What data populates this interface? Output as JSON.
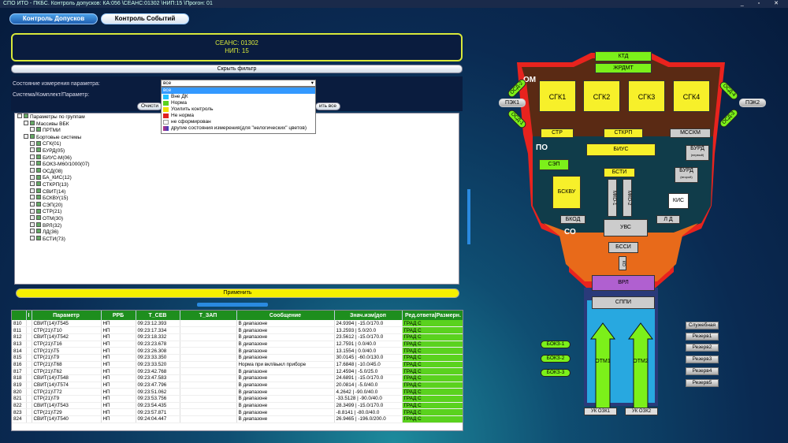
{
  "window": {
    "title": "СПО ИТО - ПКБС. Контроль допусков: КА:056 \\СЕАНС:01302 \\НИП:15 \\Прогон: 01",
    "controls": "_ ▫ ✕"
  },
  "tabs": [
    {
      "label": "Контроль Допусков"
    },
    {
      "label": "Контроль Событий"
    }
  ],
  "session": {
    "line1": "СЕАНС: 01302",
    "line2": "НИП: 15"
  },
  "filter": {
    "hide_label": "Скрыть фильтр",
    "state_label": "Состояние измерения параметра:",
    "system_label": "Система/Комплект/Параметр:",
    "select_value": "все",
    "options": [
      {
        "label": "все",
        "color": ""
      },
      {
        "label": "Вне ДК",
        "color": "#20c0ff"
      },
      {
        "label": "Норма",
        "color": "#5ad21e"
      },
      {
        "label": "Усилить контроль",
        "color": "#f0e000"
      },
      {
        "label": "Не норма",
        "color": "#e02020"
      },
      {
        "label": "не сформирован",
        "color": "#ffffff"
      },
      {
        "label": "другие состояния измерения(для \"нелогических\" цветов)",
        "color": "#c03080"
      }
    ],
    "btn_clear": "Очисти",
    "btn_select": "ить все",
    "apply": "Применить"
  },
  "tree": {
    "root": "Параметры по группам",
    "groups": [
      {
        "label": "Массивы ВБК",
        "items": [
          "ПРТМИ"
        ]
      },
      {
        "label": "Бортовые системы",
        "items": [
          "СГК(01)",
          "БУРД(05)",
          "БИУС-М(06)",
          "БОКЗ-М60/1000(07)",
          "ОСД(08)",
          "БА_КИС(12)",
          "СТКРП(13)",
          "СВИТ(14)",
          "БСКВУ(15)",
          "СЭП(20)",
          "СТР(21)",
          "ОТМ(30)",
          "ВРЛ(32)",
          "ЛД(36)",
          "БСТИ(73)"
        ]
      }
    ]
  },
  "table": {
    "columns": [
      "I",
      "Параметр",
      "РРБ",
      "Т_СЕВ",
      "Т_ЗАП",
      "Сообщение",
      "Знач.изм|доп",
      "Ред.ответа|Размерн."
    ],
    "rows": [
      [
        "810",
        "СВИТ(14)\\Т545",
        "НП",
        "09:23:12.393",
        "",
        "В диапазоне",
        "24.9394 | -15.0/170.0",
        "ГРАД С"
      ],
      [
        "811",
        "СТР(21)\\Т10",
        "НП",
        "09:23:17.334",
        "",
        "В диапазоне",
        "13.2593 | 5.0/20.0",
        "ГРАД С"
      ],
      [
        "812",
        "СВИТ(14)\\Т542",
        "НП",
        "09:23:18.332",
        "",
        "В диапазоне",
        "23.5612 | -15.0/170.0",
        "ГРАД С"
      ],
      [
        "813",
        "СТР(21)\\Т16",
        "НП",
        "09:23:23.678",
        "",
        "В диапазоне",
        "12.7591 | 0.0/40.0",
        "ГРАД С"
      ],
      [
        "814",
        "СТР(21)\\Т5",
        "НП",
        "09:23:26.308",
        "",
        "В диапазоне",
        "13.1554 | 0.0/40.0",
        "ГРАД С"
      ],
      [
        "815",
        "СТР(21)\\Т9",
        "НП",
        "09:23:33.350",
        "",
        "В диапазоне",
        "30.0145 | -60.0/130.0",
        "ГРАД С"
      ],
      [
        "816",
        "СТР(21)\\Т68",
        "НП",
        "09:23:33.520",
        "",
        "Норма при вкл/выкл приборе",
        "17.6848 | -10.0/45.0",
        "ГРАД С"
      ],
      [
        "817",
        "СТР(21)\\Т62",
        "НП",
        "09:23:42.768",
        "",
        "В диапазоне",
        "12.4594 | -5.0/25.0",
        "ГРАД С"
      ],
      [
        "818",
        "СВИТ(14)\\Т548",
        "НП",
        "09:23:47.583",
        "",
        "В диапазоне",
        "24.6891 | -15.0/170.0",
        "ГРАД С"
      ],
      [
        "819",
        "СВИТ(14)\\Т574",
        "НП",
        "09:23:47.796",
        "",
        "В диапазоне",
        "20.0814 | -5.0/40.0",
        "ГРАД С"
      ],
      [
        "820",
        "СТР(21)\\Т72",
        "НП",
        "09:23:51.062",
        "",
        "В диапазоне",
        "4.2642 | -90.0/40.0",
        "ГРАД С"
      ],
      [
        "821",
        "СТР(21)\\Т9",
        "НП",
        "09:23:53.756",
        "",
        "В диапазоне",
        "-33.5128 | -90.0/40.0",
        "ГРАД С"
      ],
      [
        "822",
        "СВИТ(14)\\Т543",
        "НП",
        "09:23:54.435",
        "",
        "В диапазоне",
        "28.3499 | -15.0/170.0",
        "ГРАД С"
      ],
      [
        "823",
        "СТР(21)\\Т29",
        "НП",
        "09:23:57.871",
        "",
        "В диапазоне",
        "-8.8141 | -80.0/40.0",
        "ГРАД С"
      ],
      [
        "824",
        "СВИТ(14)\\Т540",
        "НП",
        "09:24:04.447",
        "",
        "В диапазоне",
        "26.9465 | -196.0/200.0",
        "ГРАД С"
      ]
    ]
  },
  "diagram": {
    "top": [
      "КТД",
      "ЖРДМТ"
    ],
    "sections": [
      "ОМ",
      "ПО",
      "СО"
    ],
    "om": [
      "СГК1",
      "СГК2",
      "СГК3",
      "СГК4",
      "СТР",
      "СТКРП",
      "МССКМ"
    ],
    "po": [
      "БИУС",
      "СЭП",
      "БСТИ",
      "БСКВУ",
      "МКО-1",
      "МКО-2",
      "БУРД",
      "(первый)",
      "БУРД",
      "(второй)",
      "КИС",
      "БКОД",
      "УВС",
      "Л Д"
    ],
    "co": [
      "БССИ",
      "КО",
      "ВРЛ",
      "СППИ",
      "ОТМ1",
      "ОТМ2",
      "УК ОЗК1",
      "УК ОЗК2"
    ],
    "side_left": [
      "ПЭК1",
      "ОСД-2",
      "ОСД-1"
    ],
    "side_right": [
      "ОСД-4",
      "ОСД-3",
      "ПЭК2"
    ],
    "bokz": [
      "БОКЗ-1",
      "БОКЗ-2",
      "БОКЗ-3"
    ],
    "reserve": [
      "Служебная",
      "Резерв1",
      "Резерв2",
      "Резерв3",
      "Резерв4",
      "Резерв5"
    ]
  },
  "colors": {
    "accent_green": "#5ad21e",
    "header_green": "#1e8e1e",
    "yellow": "#f7f02a",
    "hull_red": "#e8231e"
  }
}
